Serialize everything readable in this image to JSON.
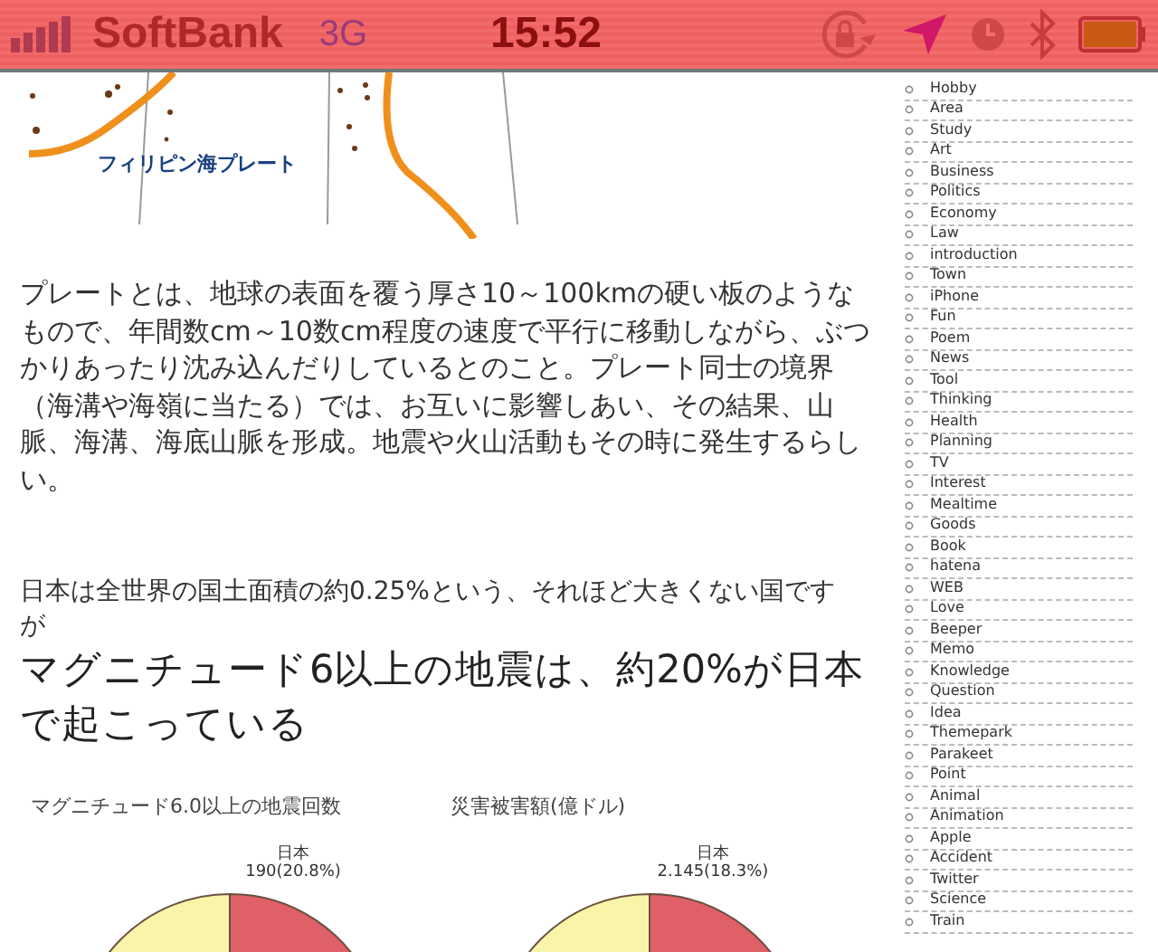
{
  "status_bar": {
    "carrier": "SoftBank",
    "network": "3G",
    "time": "15:52"
  },
  "map": {
    "label": "フィリピン海プレート"
  },
  "paragraphs": [
    "プレートとは、地球の表面を覆う厚さ10～100kmの硬い板のようなもので、年間数cm～10数cm程度の速度で平行に移動しながら、ぶつかりあったり沈み込んだりしているとのこと。プレート同士の境界（海溝や海嶺に当たる）では、お互いに影響しあい、その結果、山脈、海溝、海底山脈を形成。地震や火山活動もその時に発生するらしい。",
    "日本は全世界の国土面積の約0.25%という、それほど大きくない国ですが"
  ],
  "heading": "マグニチュード6以上の地震は、約20%が日本で起こっている",
  "charts": [
    {
      "title": "マグニチュード6.0以上の地震回数",
      "slice_label": "日本",
      "slice_value": "190(20.8%)"
    },
    {
      "title": "災害被害額(億ドル)",
      "slice_label": "日本",
      "slice_value": "2.145(18.3%)"
    }
  ],
  "sidebar": {
    "items": [
      "Hobby",
      "Area",
      "Study",
      "Art",
      "Business",
      "Politics",
      "Economy",
      "Law",
      "introduction",
      "Town",
      "iPhone",
      "Fun",
      "Poem",
      "News",
      "Tool",
      "Thinking",
      "Health",
      "Planning",
      "TV",
      "Interest",
      "Mealtime",
      "Goods",
      "Book",
      "hatena",
      "WEB",
      "Love",
      "Beeper",
      "Memo",
      "Knowledge",
      "Question",
      "Idea",
      "Themepark",
      "Parakeet",
      "Point",
      "Animal",
      "Animation",
      "Apple",
      "Accident",
      "Twitter",
      "Science",
      "Train"
    ]
  }
}
